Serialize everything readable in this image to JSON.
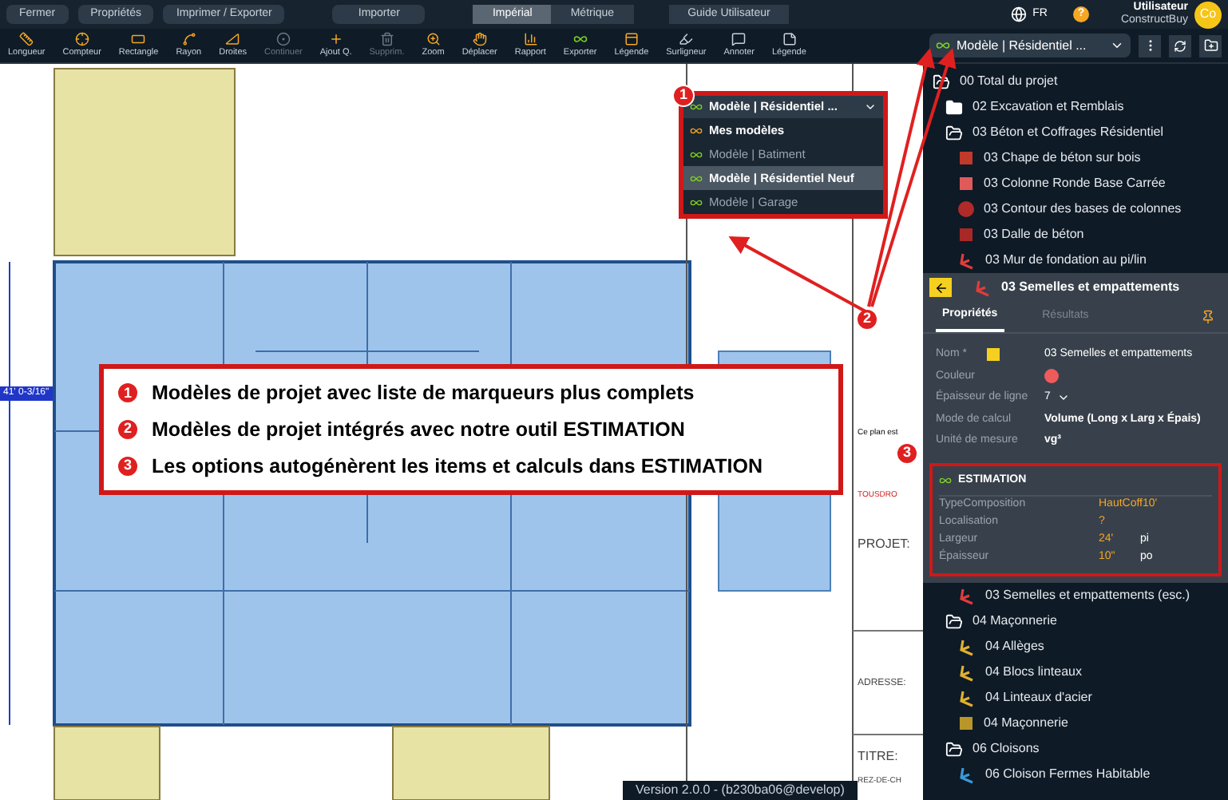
{
  "top_bar": {
    "buttons": [
      {
        "label": "Fermer"
      },
      {
        "label": "Propriétés"
      },
      {
        "label": "Imprimer / Exporter"
      },
      {
        "label": "Importer"
      }
    ],
    "units": [
      {
        "label": "Impérial",
        "selected": true
      },
      {
        "label": "Métrique",
        "selected": false
      }
    ],
    "guide": "Guide Utilisateur",
    "language": "FR",
    "help": "?",
    "user": {
      "role": "Utilisateur",
      "name": "ConstructBuy",
      "initials": "Co"
    }
  },
  "toolbar": {
    "tools": [
      {
        "label": "Longueur",
        "disabled": false
      },
      {
        "label": "Compteur",
        "disabled": false
      },
      {
        "label": "Rectangle",
        "disabled": false
      },
      {
        "label": "Rayon",
        "disabled": false
      },
      {
        "label": "Droites",
        "disabled": false
      },
      {
        "label": "Continuer",
        "disabled": true
      },
      {
        "label": "Ajout Q.",
        "disabled": false
      },
      {
        "label": "Supprim.",
        "disabled": true
      },
      {
        "label": "Zoom",
        "disabled": false
      },
      {
        "label": "Déplacer",
        "disabled": false
      },
      {
        "label": "Rapport",
        "disabled": false
      },
      {
        "label": "Exporter",
        "disabled": false
      },
      {
        "label": "Légende",
        "disabled": false
      },
      {
        "label": "Surligneur",
        "disabled": false
      },
      {
        "label": "Annoter",
        "disabled": false
      },
      {
        "label": "Légende",
        "disabled": false
      }
    ],
    "model_selector": "Modèle | Résidentiel ..."
  },
  "popup": {
    "badge": "1",
    "value": "Modèle | Résidentiel ...",
    "options": [
      {
        "label": "Mes modèles",
        "kind": "group",
        "selected": false
      },
      {
        "label": "Modèle | Batiment",
        "kind": "model",
        "selected": false
      },
      {
        "label": "Modèle | Résidentiel Neuf",
        "kind": "model",
        "selected": true
      },
      {
        "label": "Modèle | Garage",
        "kind": "model",
        "selected": false
      }
    ]
  },
  "callout": {
    "items": [
      {
        "number": "1",
        "text": "Modèles de projet avec liste de marqueurs plus complets"
      },
      {
        "number": "2",
        "text": "Modèles de projet intégrés avec notre outil ESTIMATION"
      },
      {
        "number": "3",
        "text": "Les options autogénèrent les items et calculs dans ESTIMATION"
      }
    ]
  },
  "markers": [
    {
      "number": "2"
    },
    {
      "number": "3"
    }
  ],
  "blueprint": {
    "dimension": "41' 0-3/16\"",
    "note": "Ce plan est",
    "stamp": "TOUSDRO",
    "project": "PROJET:",
    "address": "ADRESSE:",
    "title": "TITRE:",
    "level": "REZ-DE-CH"
  },
  "tree": [
    {
      "label": "00 Total du projet",
      "kind": "folder-open",
      "selected": false,
      "children": [
        {
          "label": "02 Excavation et Remblais",
          "kind": "folder",
          "selected": false
        },
        {
          "label": "03 Béton et Coffrages Résidentiel",
          "kind": "folder-open",
          "selected": false,
          "children": [
            {
              "label": "03 Chape de béton sur bois",
              "kind": "area",
              "color": "#c0392b",
              "selected": false
            },
            {
              "label": "03 Colonne Ronde Base Carrée",
              "kind": "area",
              "color": "#e05a5a",
              "selected": false
            },
            {
              "label": "03 Contour des bases de colonnes",
              "kind": "circle",
              "color": "#b02a2a",
              "selected": false
            },
            {
              "label": "03 Dalle de béton",
              "kind": "area",
              "color": "#a82828",
              "selected": false
            },
            {
              "label": "03 Mur de fondation au pi/lin",
              "kind": "line",
              "color": "#e03c3c",
              "selected": false
            },
            {
              "label": "03 Semelles et empattements",
              "kind": "line",
              "color": "#e03c3c",
              "selected": true
            },
            {
              "label": "03 Semelles et empattements (esc.)",
              "kind": "line",
              "color": "#e03c3c",
              "selected": false
            }
          ]
        },
        {
          "label": "04 Maçonnerie",
          "kind": "folder-open",
          "selected": false,
          "children": [
            {
              "label": "04 Allèges",
              "kind": "line",
              "color": "#e0b030",
              "selected": false
            },
            {
              "label": "04 Blocs linteaux",
              "kind": "line",
              "color": "#e0b030",
              "selected": false
            },
            {
              "label": "04 Linteaux d'acier",
              "kind": "line",
              "color": "#e0b030",
              "selected": false
            },
            {
              "label": "04 Maçonnerie",
              "kind": "area",
              "color": "#b8962a",
              "selected": false
            }
          ]
        },
        {
          "label": "06 Cloisons",
          "kind": "folder-open",
          "selected": false,
          "children": [
            {
              "label": "06 Cloison Fermes Habitable",
              "kind": "line",
              "color": "#3a9ad9",
              "selected": false
            }
          ]
        }
      ]
    }
  ],
  "properties": {
    "tabs": [
      {
        "label": "Propriétés",
        "selected": true
      },
      {
        "label": "Résultats",
        "selected": false
      }
    ],
    "name_label": "Nom *",
    "name": "03 Semelles et empattements",
    "color_label": "Couleur",
    "color": "#ef5b5b",
    "line_label": "Épaisseur de ligne",
    "line": "7",
    "mode_label": "Mode de calcul",
    "mode": "Volume (Long x Larg x Épais)",
    "unit_label": "Unité de mesure",
    "unit": "vg³",
    "estimation": {
      "title": "ESTIMATION",
      "rows": [
        {
          "label": "TypeComposition",
          "value": "HautCoff10'"
        },
        {
          "label": "Localisation",
          "value": "?"
        },
        {
          "label": "Largeur",
          "value": "24'",
          "unit": "pi"
        },
        {
          "label": "Épaisseur",
          "value": "10\"",
          "unit": "po"
        }
      ]
    }
  },
  "status": "Version 2.0.0 - (b230ba06@develop)"
}
